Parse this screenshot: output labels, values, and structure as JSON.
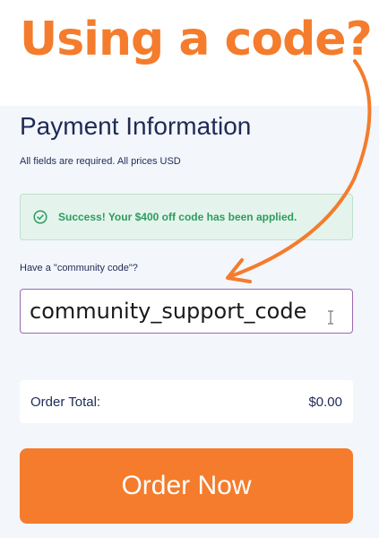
{
  "headline": "Using a code?",
  "form": {
    "title": "Payment Information",
    "subtitle": "All fields are required.  All prices USD",
    "success_message": "Success! Your $400 off code has been applied.",
    "code_label": "Have a \"community code\"?",
    "code_value": "community_support_code",
    "order_total_label": "Order Total:",
    "order_total_value": "$0.00",
    "order_button_label": "Order Now"
  },
  "icons": {
    "success": "check-circle-icon",
    "text_cursor": "text-cursor-icon",
    "annotation": "curved-arrow-icon"
  },
  "colors": {
    "accent": "#f47c2c",
    "navy": "#1f2a55",
    "success": "#2e9b5f",
    "success_bg": "#e4f4ec",
    "input_border": "#9a6ab2",
    "panel_bg": "#f3f6fb"
  }
}
